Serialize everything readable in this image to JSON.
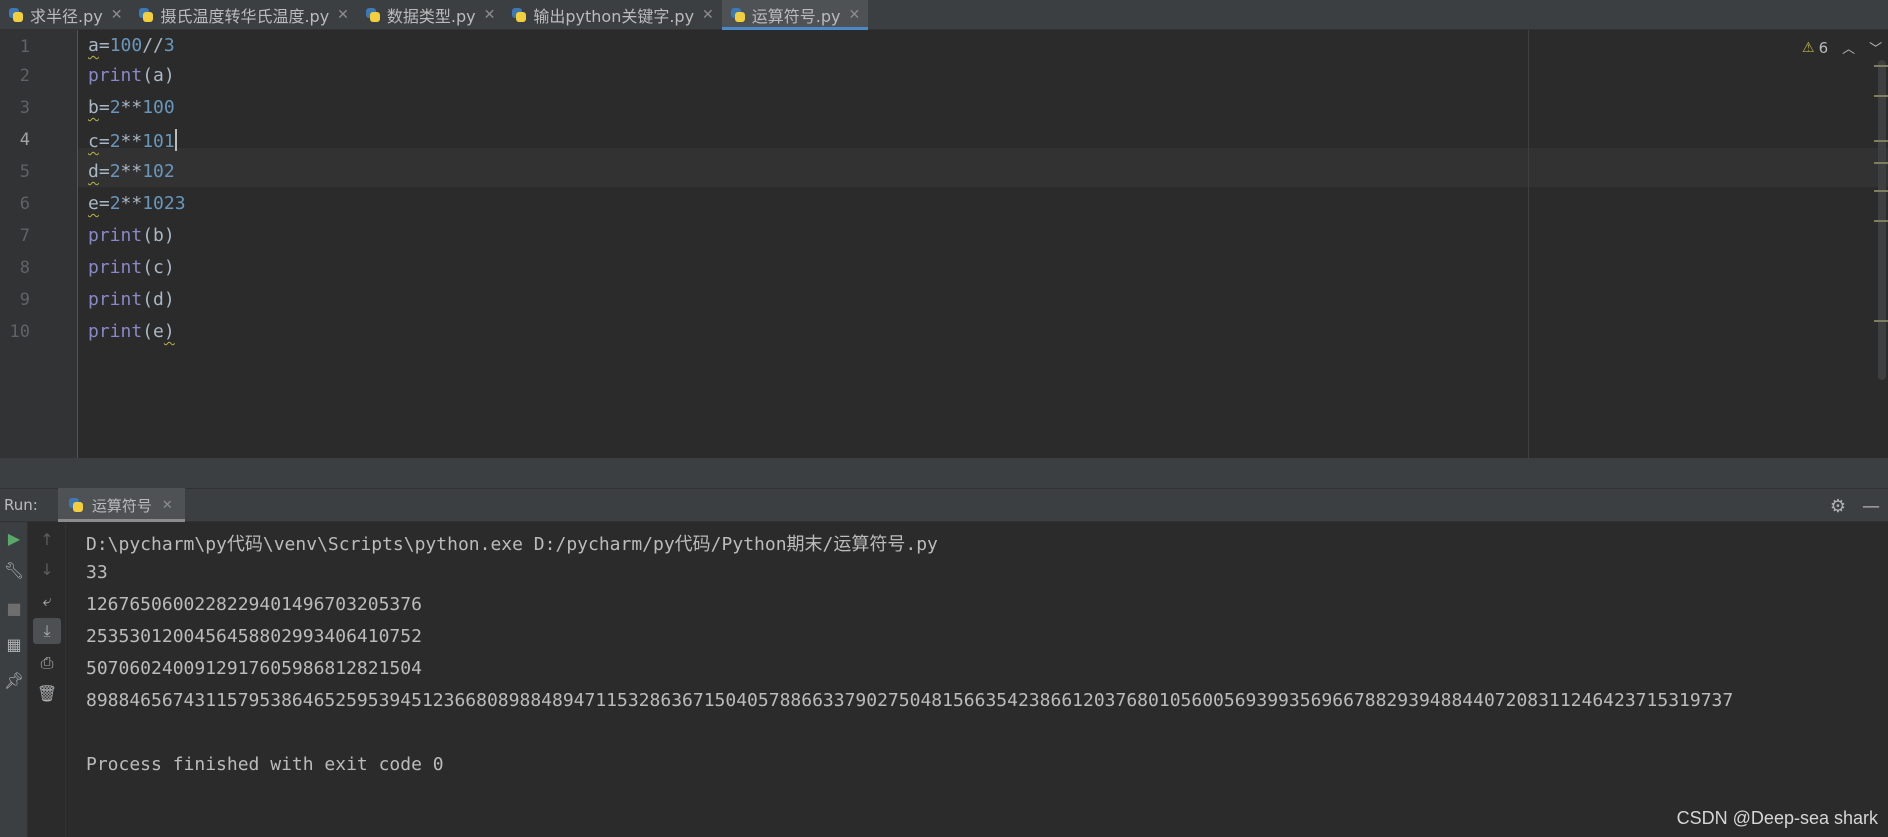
{
  "tabs": [
    {
      "label": "求半径.py",
      "active": false
    },
    {
      "label": "摄氏温度转华氏温度.py",
      "active": false
    },
    {
      "label": "数据类型.py",
      "active": false
    },
    {
      "label": "输出python关键字.py",
      "active": false
    },
    {
      "label": "运算符号.py",
      "active": true
    }
  ],
  "editor": {
    "line_numbers": [
      "1",
      "2",
      "3",
      "4",
      "5",
      "6",
      "7",
      "8",
      "9",
      "10"
    ],
    "current_line": 4,
    "warning_count": "6",
    "code": [
      {
        "a": "a",
        "b": "=",
        "c": "100",
        "d": "//",
        "e": "3"
      },
      {
        "a": "print",
        "b": "(",
        "c": "a",
        "d": ")"
      },
      {
        "a": "b",
        "b": "=",
        "c": "2",
        "d": "**",
        "e": "100"
      },
      {
        "a": "c",
        "b": "=",
        "c": "2",
        "d": "**",
        "e": "101"
      },
      {
        "a": "d",
        "b": "=",
        "c": "2",
        "d": "**",
        "e": "102"
      },
      {
        "a": "e",
        "b": "=",
        "c": "2",
        "d": "**",
        "e": "1023"
      },
      {
        "a": "print",
        "b": "(",
        "c": "b",
        "d": ")"
      },
      {
        "a": "print",
        "b": "(",
        "c": "c",
        "d": ")"
      },
      {
        "a": "print",
        "b": "(",
        "c": "d",
        "d": ")"
      },
      {
        "a": "print",
        "b": "(",
        "c": "e",
        "d": ")"
      }
    ]
  },
  "run": {
    "label": "Run:",
    "tab_label": "运算符号",
    "console": [
      "D:\\pycharm\\py代码\\venv\\Scripts\\python.exe D:/pycharm/py代码/Python期末/运算符号.py",
      "33",
      "1267650600228229401496703205376",
      "2535301200456458802993406410752",
      "5070602400912917605986812821504",
      "89884656743115795386465259539451236680898848947115328636715040578866337902750481566354238661203768010560056939935696678829394884407208311246423715319737",
      "",
      "Process finished with exit code 0"
    ]
  },
  "watermark": "CSDN @Deep-sea shark",
  "colors": {
    "background": "#2b2b2b",
    "number": "#6897bb",
    "builtin": "#8888c6",
    "accent": "#4a88c7",
    "run_green": "#59a869"
  }
}
